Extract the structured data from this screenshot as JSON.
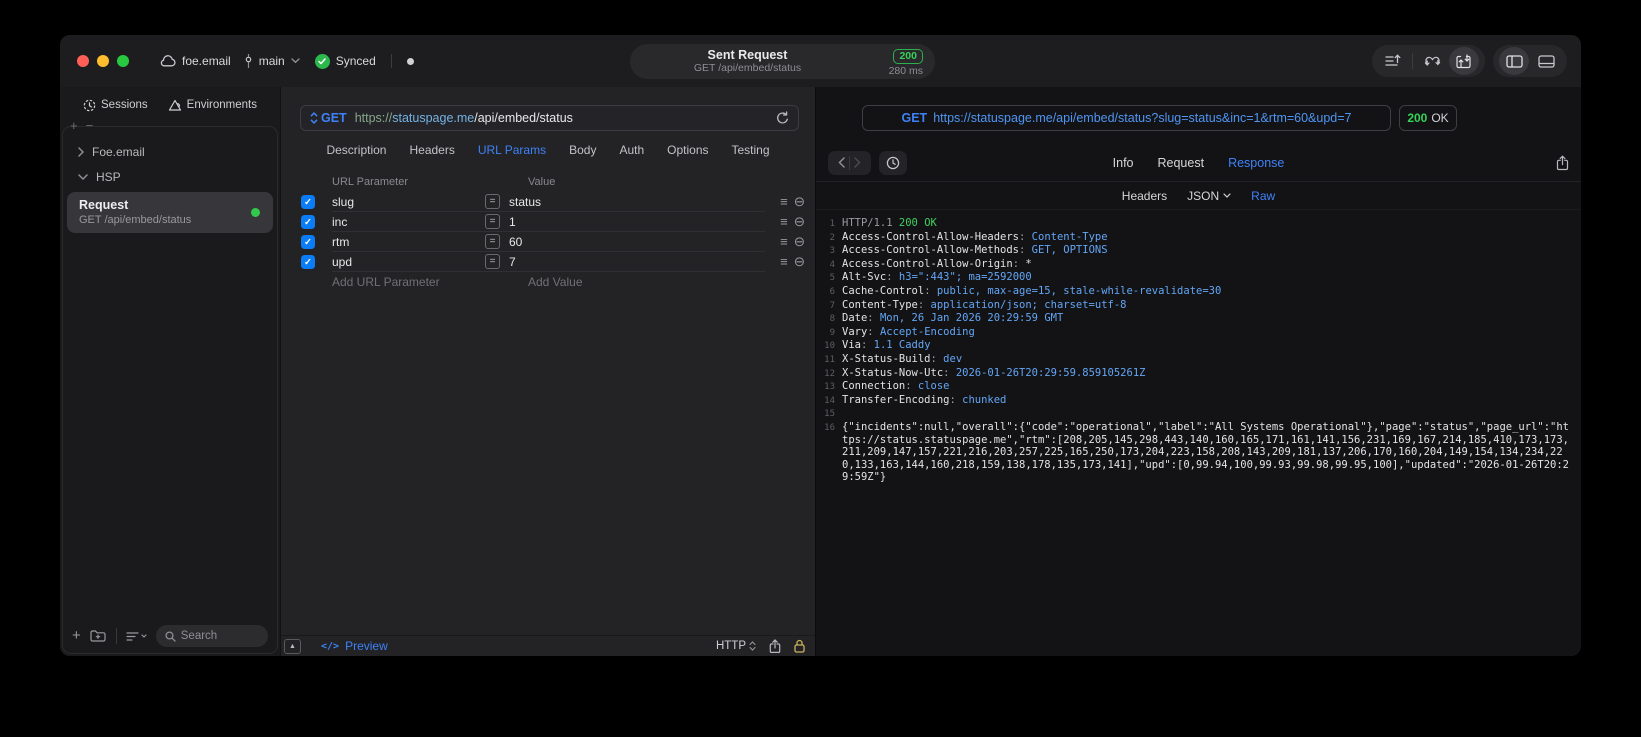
{
  "titlebar": {
    "project": "foe.email",
    "branch": "main",
    "sync_status": "Synced",
    "request_pill": {
      "title": "Sent Request",
      "subtitle": "GET /api/embed/status",
      "status_code": "200",
      "duration": "280 ms"
    }
  },
  "sidebar": {
    "tabs": [
      {
        "label": "Sessions",
        "icon": "clock-icon"
      },
      {
        "label": "Environments",
        "icon": "environments-icon"
      }
    ],
    "tree": [
      {
        "label": "Foe.email",
        "state": "collapsed"
      },
      {
        "label": "HSP",
        "state": "expanded"
      }
    ],
    "request_item": {
      "title": "Request",
      "subtitle": "GET /api/embed/status",
      "indicator_color": "#32c94c"
    },
    "search_placeholder": "Search"
  },
  "request_panel": {
    "method": "GET",
    "url": {
      "scheme": "https://",
      "host": "statuspage.me",
      "path": "/api/embed/status"
    },
    "tabs": [
      "Description",
      "Headers",
      "URL Params",
      "Body",
      "Auth",
      "Options",
      "Testing"
    ],
    "active_tab": "URL Params",
    "params_table": {
      "columns": [
        "URL Parameter",
        "Value"
      ],
      "rows": [
        {
          "name": "slug",
          "value": "status",
          "enabled": true
        },
        {
          "name": "inc",
          "value": "1",
          "enabled": true
        },
        {
          "name": "rtm",
          "value": "60",
          "enabled": true
        },
        {
          "name": "upd",
          "value": "7",
          "enabled": true
        }
      ],
      "add_row": {
        "name_placeholder": "Add URL Parameter",
        "value_placeholder": "Add Value"
      }
    },
    "footer": {
      "preview_label": "Preview",
      "protocol_label": "HTTP"
    }
  },
  "response_panel": {
    "request_line": {
      "method": "GET",
      "url": "https://statuspage.me/api/embed/status?slug=status&inc=1&rtm=60&upd=7"
    },
    "status": {
      "code": "200",
      "text": "OK"
    },
    "tabs": [
      "Info",
      "Request",
      "Response"
    ],
    "active_tab": "Response",
    "view_tabs": [
      "Headers",
      "JSON",
      "Raw"
    ],
    "active_view_tab": "Raw",
    "raw": {
      "lines": [
        {
          "n": "1",
          "parts": [
            {
              "text": "HTTP/1.1 ",
              "cls": "dim"
            },
            {
              "text": "200 OK",
              "cls": "status"
            }
          ]
        },
        {
          "n": "2",
          "parts": [
            {
              "text": "Access-Control-Allow-Headers",
              "cls": "plain"
            },
            {
              "text": ": ",
              "cls": "dim"
            },
            {
              "text": "Content-Type",
              "cls": "value"
            }
          ]
        },
        {
          "n": "3",
          "parts": [
            {
              "text": "Access-Control-Allow-Methods",
              "cls": "plain"
            },
            {
              "text": ": ",
              "cls": "dim"
            },
            {
              "text": "GET, OPTIONS",
              "cls": "value"
            }
          ]
        },
        {
          "n": "4",
          "parts": [
            {
              "text": "Access-Control-Allow-Origin",
              "cls": "plain"
            },
            {
              "text": ": ",
              "cls": "dim"
            },
            {
              "text": "*",
              "cls": "plain"
            }
          ]
        },
        {
          "n": "5",
          "parts": [
            {
              "text": "Alt-Svc",
              "cls": "plain"
            },
            {
              "text": ": ",
              "cls": "dim"
            },
            {
              "text": "h3=\":443\"; ma=2592000",
              "cls": "value"
            }
          ]
        },
        {
          "n": "6",
          "parts": [
            {
              "text": "Cache-Control",
              "cls": "plain"
            },
            {
              "text": ": ",
              "cls": "dim"
            },
            {
              "text": "public, max-age=15, stale-while-revalidate=30",
              "cls": "value"
            }
          ]
        },
        {
          "n": "7",
          "parts": [
            {
              "text": "Content-Type",
              "cls": "plain"
            },
            {
              "text": ": ",
              "cls": "dim"
            },
            {
              "text": "application/json; charset=utf-8",
              "cls": "value"
            }
          ]
        },
        {
          "n": "8",
          "parts": [
            {
              "text": "Date",
              "cls": "plain"
            },
            {
              "text": ": ",
              "cls": "dim"
            },
            {
              "text": "Mon, 26 Jan 2026 20:29:59 GMT",
              "cls": "value"
            }
          ]
        },
        {
          "n": "9",
          "parts": [
            {
              "text": "Vary",
              "cls": "plain"
            },
            {
              "text": ": ",
              "cls": "dim"
            },
            {
              "text": "Accept-Encoding",
              "cls": "value"
            }
          ]
        },
        {
          "n": "10",
          "parts": [
            {
              "text": "Via",
              "cls": "plain"
            },
            {
              "text": ": ",
              "cls": "dim"
            },
            {
              "text": "1.1 Caddy",
              "cls": "value"
            }
          ]
        },
        {
          "n": "11",
          "parts": [
            {
              "text": "X-Status-Build",
              "cls": "plain"
            },
            {
              "text": ": ",
              "cls": "dim"
            },
            {
              "text": "dev",
              "cls": "value"
            }
          ]
        },
        {
          "n": "12",
          "parts": [
            {
              "text": "X-Status-Now-Utc",
              "cls": "plain"
            },
            {
              "text": ": ",
              "cls": "dim"
            },
            {
              "text": "2026-01-26T20:29:59.859105261Z",
              "cls": "value"
            }
          ]
        },
        {
          "n": "13",
          "parts": [
            {
              "text": "Connection",
              "cls": "plain"
            },
            {
              "text": ": ",
              "cls": "dim"
            },
            {
              "text": "close",
              "cls": "value"
            }
          ]
        },
        {
          "n": "14",
          "parts": [
            {
              "text": "Transfer-Encoding",
              "cls": "plain"
            },
            {
              "text": ": ",
              "cls": "dim"
            },
            {
              "text": "chunked",
              "cls": "value"
            }
          ]
        },
        {
          "n": "15",
          "parts": []
        },
        {
          "n": "16",
          "parts": [
            {
              "text": "{\"incidents\":null,\"overall\":{\"code\":\"operational\",\"label\":\"All Systems Operational\"},\"page\":\"status\",\"page_url\":\"https://status.statuspage.me\",\"rtm\":[208,205,145,298,443,140,160,165,171,161,141,156,231,169,167,214,185,410,173,173,211,209,147,157,221,216,203,257,225,165,250,173,204,223,158,208,143,209,181,137,206,170,160,204,149,154,134,234,220,133,163,144,160,218,159,138,178,135,173,141],\"upd\":[0,99.94,100,99.93,99.98,99.95,100],\"updated\":\"2026-01-26T20:29:59Z\"}",
              "cls": "plain"
            }
          ]
        }
      ]
    }
  },
  "colors": {
    "accent_blue": "#3e82f7",
    "status_green": "#36d158",
    "checkbox_blue": "#0a7cf5",
    "lock_gold": "#cbb35e"
  }
}
